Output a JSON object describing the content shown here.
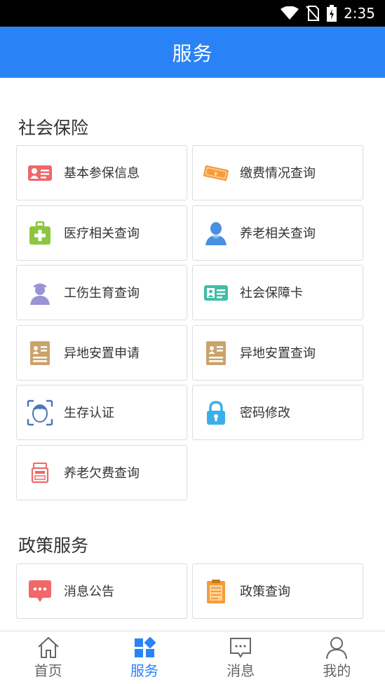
{
  "status_bar": {
    "time": "2:35"
  },
  "header": {
    "title": "服务"
  },
  "sections": [
    {
      "title": "社会保险",
      "items": [
        {
          "label": "基本参保信息",
          "icon": "id-card-icon",
          "color": "#f0686a"
        },
        {
          "label": "缴费情况查询",
          "icon": "ticket-icon",
          "color": "#f59c3a"
        },
        {
          "label": "医疗相关查询",
          "icon": "medical-kit-icon",
          "color": "#8cc63e"
        },
        {
          "label": "养老相关查询",
          "icon": "person-icon",
          "color": "#4a90e2"
        },
        {
          "label": "工伤生育查询",
          "icon": "worker-icon",
          "color": "#9a94d6"
        },
        {
          "label": "社会保障卡",
          "icon": "social-card-icon",
          "color": "#3fbfa4"
        },
        {
          "label": "异地安置申请",
          "icon": "document-person-icon",
          "color": "#c9a46a"
        },
        {
          "label": "异地安置查询",
          "icon": "document-person-icon",
          "color": "#c9a46a"
        },
        {
          "label": "生存认证",
          "icon": "face-scan-icon",
          "color": "#4a78b8"
        },
        {
          "label": "密码修改",
          "icon": "lock-icon",
          "color": "#3ab0ea"
        },
        {
          "label": "养老欠费查询",
          "icon": "cash-register-icon",
          "color": "#f0686a"
        }
      ]
    },
    {
      "title": "政策服务",
      "items": [
        {
          "label": "消息公告",
          "icon": "chat-bubble-icon",
          "color": "#f0686a"
        },
        {
          "label": "政策查询",
          "icon": "clipboard-icon",
          "color": "#f59c3a"
        }
      ]
    }
  ],
  "bottom_nav": [
    {
      "label": "首页",
      "icon": "home-icon",
      "active": false
    },
    {
      "label": "服务",
      "icon": "grid-icon",
      "active": true
    },
    {
      "label": "消息",
      "icon": "message-icon",
      "active": false
    },
    {
      "label": "我的",
      "icon": "user-icon",
      "active": false
    }
  ],
  "colors": {
    "primary": "#2a83f6",
    "text": "#333333",
    "border": "#dcdcdc"
  }
}
